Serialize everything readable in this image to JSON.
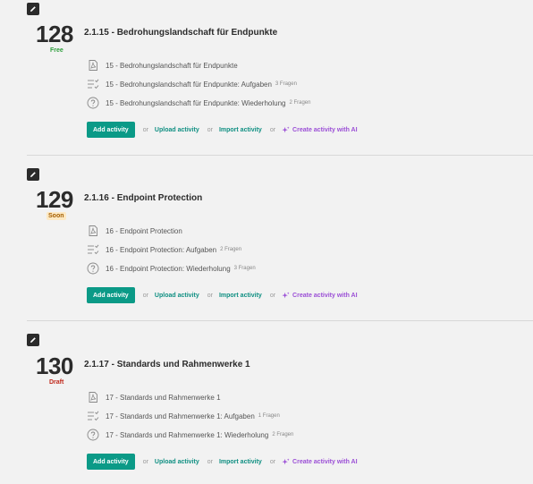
{
  "sections": [
    {
      "number": "128",
      "badge": "Free",
      "title": "2.1.15 - Bedrohungslandschaft für Endpunkte",
      "items": [
        {
          "icon": "pdf-icon",
          "label": "15 - Bedrohungslandschaft für Endpunkte",
          "count": ""
        },
        {
          "icon": "checklist-icon",
          "label": "15 - Bedrohungslandschaft für Endpunkte: Aufgaben",
          "count": "3 Fragen"
        },
        {
          "icon": "question-icon",
          "label": "15 - Bedrohungslandschaft für Endpunkte: Wiederholung",
          "count": "2 Fragen"
        }
      ]
    },
    {
      "number": "129",
      "badge": "Soon",
      "title": "2.1.16 - Endpoint Protection",
      "items": [
        {
          "icon": "pdf-icon",
          "label": "16 - Endpoint Protection",
          "count": ""
        },
        {
          "icon": "checklist-icon",
          "label": "16 - Endpoint Protection: Aufgaben",
          "count": "2 Fragen"
        },
        {
          "icon": "question-icon",
          "label": "16 - Endpoint Protection: Wiederholung",
          "count": "3 Fragen"
        }
      ]
    },
    {
      "number": "130",
      "badge": "Draft",
      "title": "2.1.17 - Standards und Rahmenwerke 1",
      "items": [
        {
          "icon": "pdf-icon",
          "label": "17 - Standards und Rahmenwerke 1",
          "count": ""
        },
        {
          "icon": "checklist-icon",
          "label": "17 - Standards und Rahmenwerke 1: Aufgaben",
          "count": "1 Fragen"
        },
        {
          "icon": "question-icon",
          "label": "17 - Standards und Rahmenwerke 1: Wiederholung",
          "count": "2 Fragen"
        }
      ]
    }
  ],
  "actions": {
    "add": "Add activity",
    "or": "or",
    "upload": "Upload activity",
    "import": "Import activity",
    "ai": "Create activity with AI"
  },
  "colors": {
    "accent": "#0b9a87",
    "link": "#0f8f82",
    "ai": "#9b4fd6",
    "free": "#2e9e3c",
    "soon": "#a35d00",
    "draft": "#c0281b"
  }
}
